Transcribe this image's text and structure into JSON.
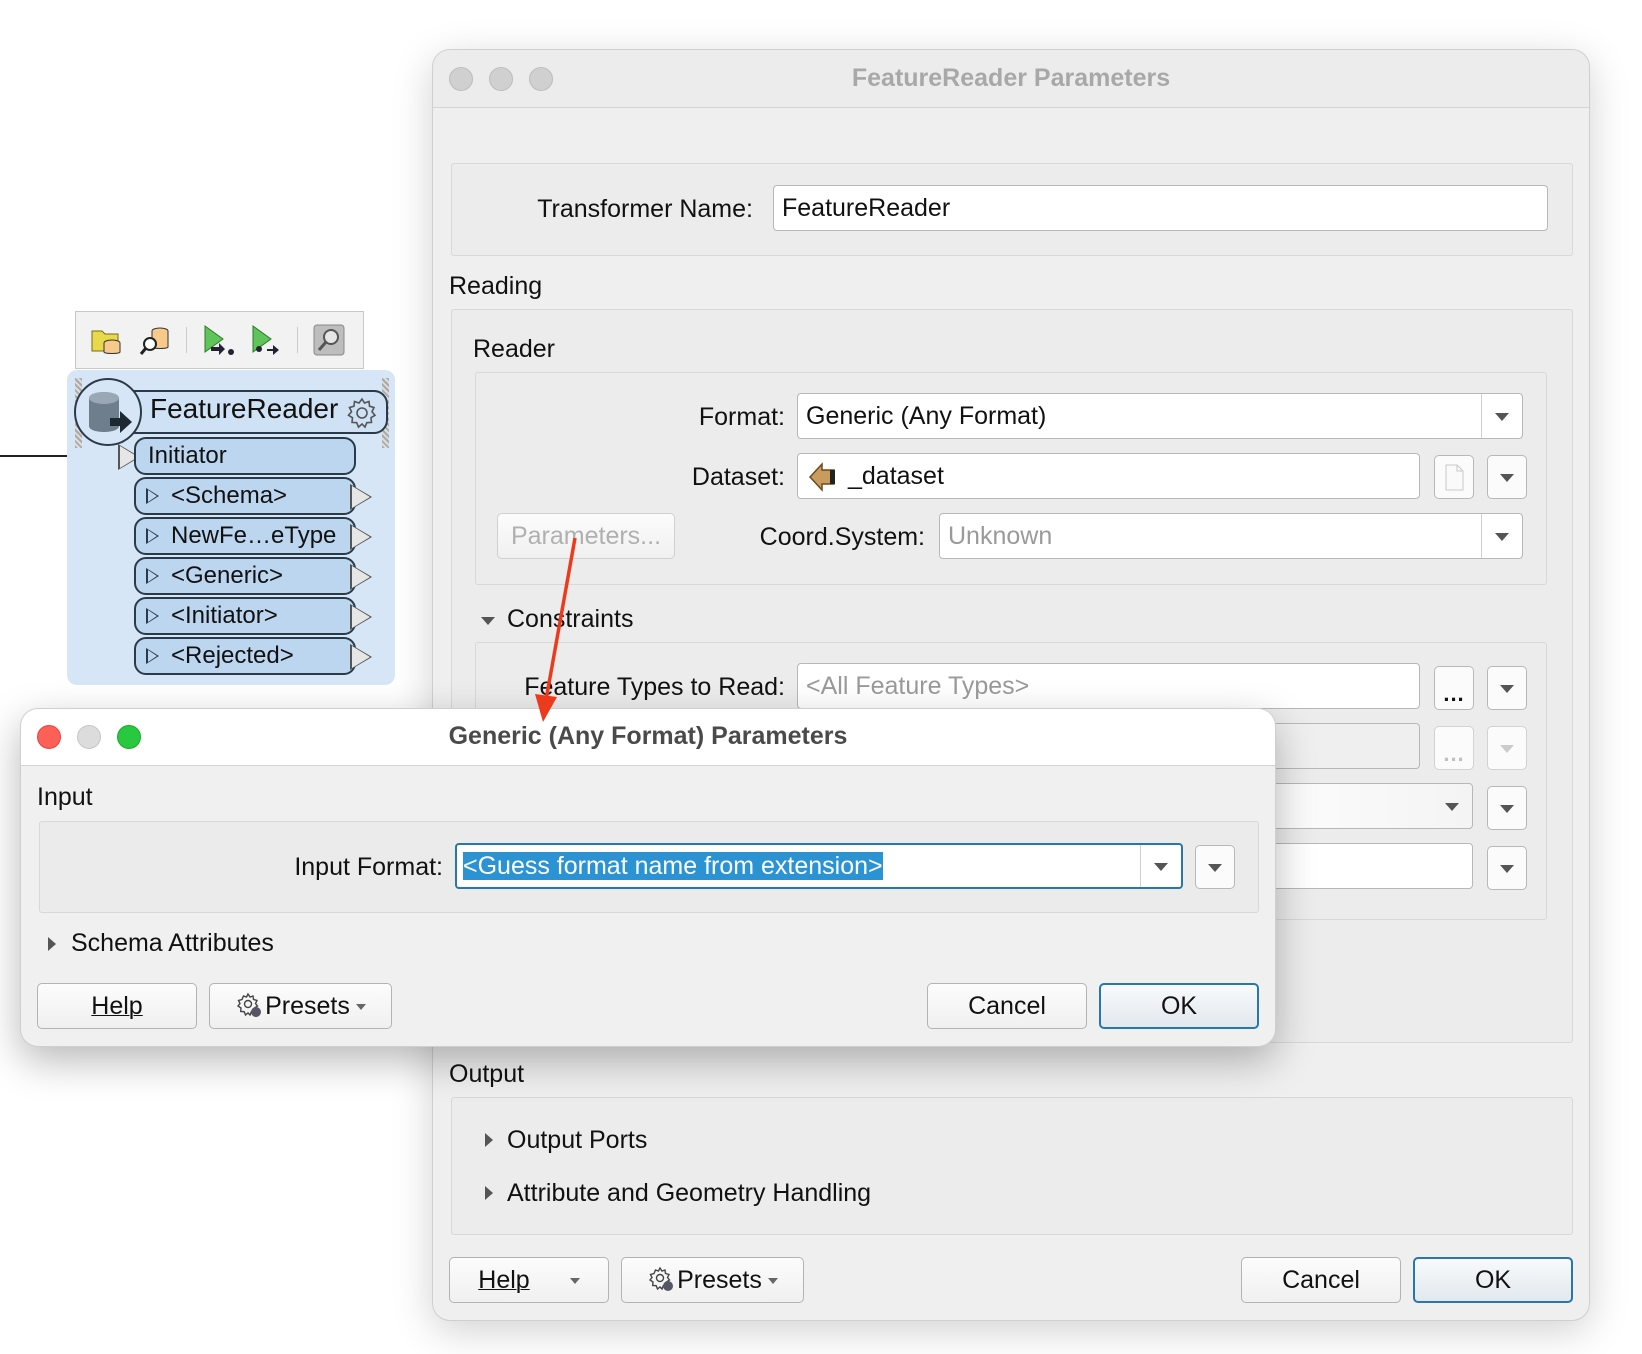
{
  "canvas": {
    "toolbar": {
      "icons": [
        "open-reader-dataset-icon",
        "inspect-reader-icon",
        "run-to-this-icon",
        "run-from-this-icon",
        "inspect-cache-icon"
      ]
    },
    "node": {
      "title": "FeatureReader",
      "input_port": "Initiator",
      "output_ports": [
        "<Schema>",
        "NewFe…eType",
        "<Generic>",
        "<Initiator>",
        "<Rejected>"
      ]
    }
  },
  "main_dialog": {
    "title": "FeatureReader Parameters",
    "transformer_name_label": "Transformer Name:",
    "transformer_name_value": "FeatureReader",
    "reading_label": "Reading",
    "reader_label": "Reader",
    "format_label": "Format:",
    "format_value": "Generic (Any Format)",
    "dataset_label": "Dataset:",
    "dataset_value": "_dataset",
    "parameters_button": "Parameters...",
    "coord_label": "Coord.System:",
    "coord_value": "Unknown",
    "constraints_label": "Constraints",
    "feature_types_label": "Feature Types to Read:",
    "feature_types_placeholder": "<All Feature Types>",
    "ellipsis": "...",
    "output_label": "Output",
    "output_ports_label": "Output Ports",
    "attr_geom_label": "Attribute and Geometry Handling",
    "help_button": "Help",
    "presets_button": "Presets",
    "cancel_button": "Cancel",
    "ok_button": "OK"
  },
  "sub_dialog": {
    "title": "Generic (Any Format) Parameters",
    "input_label": "Input",
    "input_format_label": "Input Format:",
    "input_format_value": "<Guess format name from extension>",
    "schema_attributes_label": "Schema Attributes",
    "help_button": "Help",
    "presets_button": "Presets",
    "cancel_button": "Cancel",
    "ok_button": "OK"
  },
  "colors": {
    "selection": "#2b93d4",
    "default_button_border": "#2677ad",
    "annotation_arrow": "#ee3a1c",
    "node_fill": "#bcd6f0",
    "close_light": "#fe5f57",
    "zoom_light": "#28c840"
  }
}
